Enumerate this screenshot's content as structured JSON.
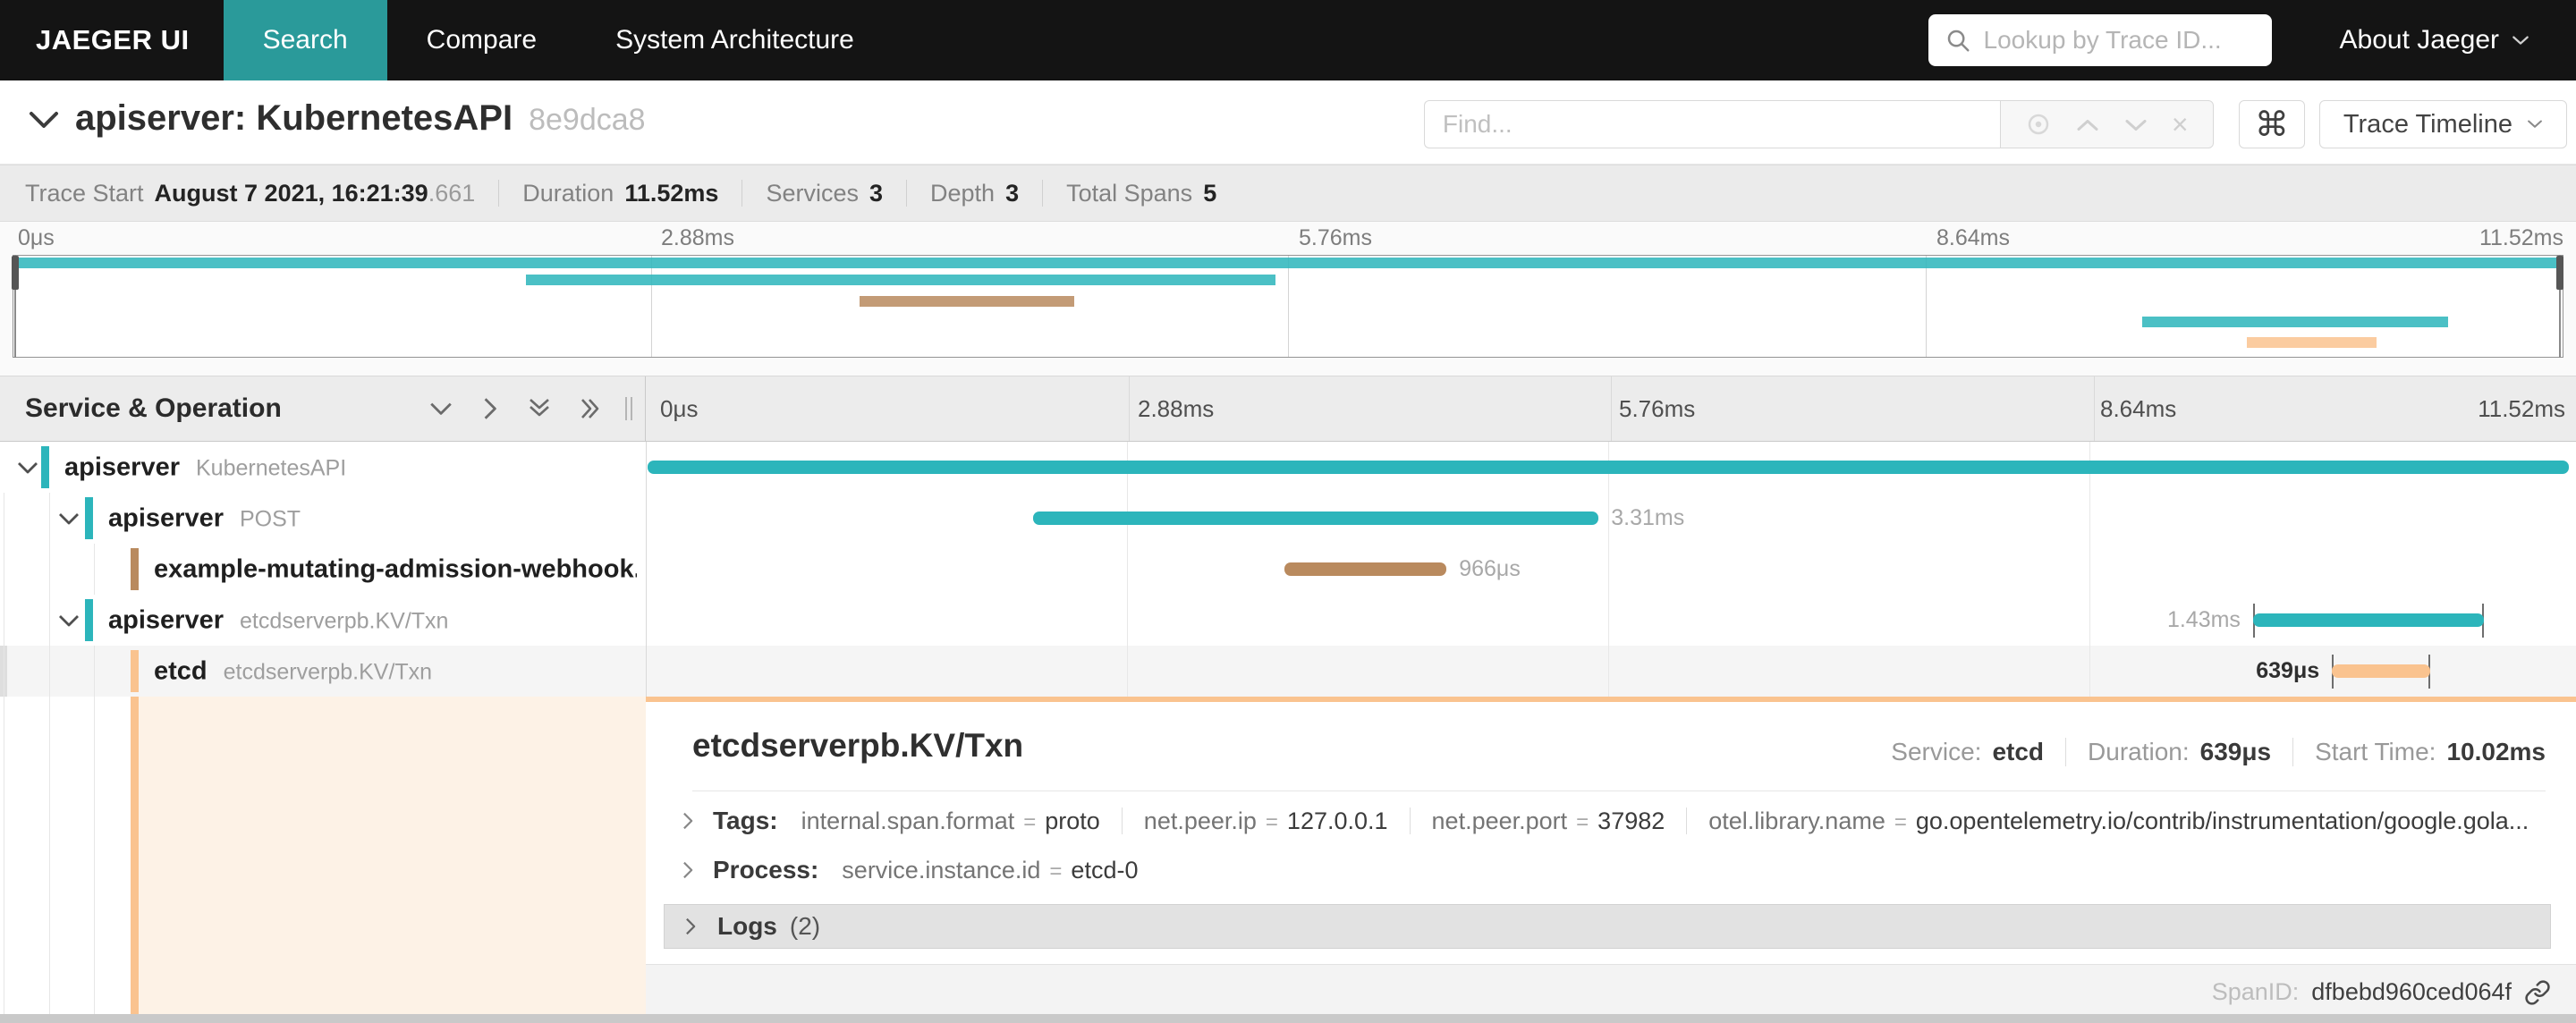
{
  "colors": {
    "teal": "#2cb5bb",
    "brown": "#b98a5e",
    "peach": "#fac38f",
    "nav_bg": "#141414",
    "nav_active": "#2a9a9a",
    "selected_row_bg": "#f5f5f5",
    "detail_tint": "#fdf2e6"
  },
  "icons": {
    "command_glyph": "⌘",
    "close_glyph": "×"
  },
  "nav": {
    "brand": "JAEGER UI",
    "items": [
      {
        "label": "Search",
        "active": true
      },
      {
        "label": "Compare",
        "active": false
      },
      {
        "label": "System Architecture",
        "active": false
      }
    ],
    "lookup_placeholder": "Lookup by Trace ID...",
    "about": "About Jaeger"
  },
  "trace_header": {
    "title": "apiserver: KubernetesAPI",
    "trace_id_short": "8e9dca8",
    "find_placeholder": "Find...",
    "view_selector": "Trace Timeline"
  },
  "summary": {
    "trace_start_label": "Trace Start",
    "trace_start_value": "August 7 2021, 16:21:39",
    "trace_start_fraction": ".661",
    "duration_label": "Duration",
    "duration_value": "11.52ms",
    "services_label": "Services",
    "services_value": "3",
    "depth_label": "Depth",
    "depth_value": "3",
    "total_spans_label": "Total Spans",
    "total_spans_value": "5"
  },
  "timeline": {
    "header_left": "Service & Operation",
    "ticks": [
      "0μs",
      "2.88ms",
      "5.76ms",
      "8.64ms",
      "11.52ms"
    ]
  },
  "spans": [
    {
      "service": "apiserver",
      "operation": "KubernetesAPI",
      "depth": 0,
      "color": "teal",
      "start_pct": 0.1,
      "width_pct": 99.8,
      "label": "",
      "label_side": "right",
      "has_children": true,
      "edge_ticks": false,
      "selected": false
    },
    {
      "service": "apiserver",
      "operation": "POST",
      "depth": 1,
      "color": "teal",
      "start_pct": 20.1,
      "width_pct": 29.4,
      "label": "3.31ms",
      "label_side": "right",
      "has_children": true,
      "edge_ticks": false,
      "selected": false
    },
    {
      "service": "example-mutating-admission-webhook...",
      "operation": "",
      "depth": 2,
      "color": "brown",
      "start_pct": 33.2,
      "width_pct": 8.4,
      "label": "966μs",
      "label_side": "right",
      "has_children": false,
      "edge_ticks": false,
      "selected": false
    },
    {
      "service": "apiserver",
      "operation": "etcdserverpb.KV/Txn",
      "depth": 1,
      "color": "teal",
      "start_pct": 83.5,
      "width_pct": 12.0,
      "label": "1.43ms",
      "label_side": "left",
      "has_children": true,
      "edge_ticks": true,
      "selected": false
    },
    {
      "service": "etcd",
      "operation": "etcdserverpb.KV/Txn",
      "depth": 2,
      "color": "peach",
      "start_pct": 87.6,
      "width_pct": 5.1,
      "label": "639μs",
      "label_side": "left",
      "has_children": false,
      "edge_ticks": true,
      "selected": true
    }
  ],
  "detail": {
    "title": "etcdserverpb.KV/Txn",
    "service_label": "Service:",
    "service_value": "etcd",
    "duration_label": "Duration:",
    "duration_value": "639μs",
    "start_label": "Start Time:",
    "start_value": "10.02ms",
    "eq": "=",
    "tags_label": "Tags:",
    "tags": [
      {
        "key": "internal.span.format",
        "value": "proto"
      },
      {
        "key": "net.peer.ip",
        "value": "127.0.0.1"
      },
      {
        "key": "net.peer.port",
        "value": "37982"
      },
      {
        "key": "otel.library.name",
        "value": "go.opentelemetry.io/contrib/instrumentation/google.gola..."
      }
    ],
    "process_label": "Process:",
    "process": [
      {
        "key": "service.instance.id",
        "value": "etcd-0"
      }
    ],
    "logs_label": "Logs",
    "logs_count": "(2)",
    "spanid_label": "SpanID:",
    "spanid_value": "dfbebd960ced064f"
  }
}
